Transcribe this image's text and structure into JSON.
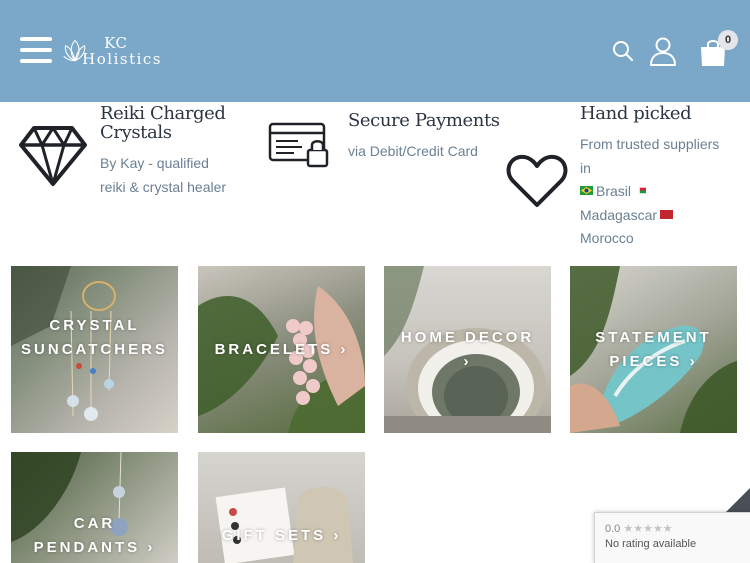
{
  "header": {
    "logo_line1": "KC",
    "logo_line2": "Holistics",
    "cart_count": "0",
    "bg_color": "#7ba8c9"
  },
  "features": [
    {
      "icon": "diamond-icon",
      "title_line1": "Reiki Charged",
      "title_line2": "Crystals",
      "sub_line1": "By Kay - qualified",
      "sub_line2": "reiki & crystal healer"
    },
    {
      "icon": "secure-card-icon",
      "title_line1": "Secure Payments",
      "sub_line1": "via Debit/Credit Card"
    },
    {
      "icon": "heart-icon",
      "title_line1": "Hand picked",
      "sub_line1": "From trusted suppliers",
      "sub_line2": "in",
      "country1": "Brasil",
      "country2": "Madagascar",
      "country3": "Morocco"
    }
  ],
  "tiles": [
    {
      "line1": "CRYSTAL",
      "line2": "SUNCATCHERS"
    },
    {
      "line1": "BRACELETS ›"
    },
    {
      "line1": "HOME DECOR",
      "line2": "›"
    },
    {
      "line1": "STATEMENT",
      "line2": "PIECES ›"
    },
    {
      "line1": "CAR",
      "line2": "PENDANTS ›"
    },
    {
      "line1": "GIFT SETS ›"
    }
  ],
  "recaptcha": {
    "score": "0.0",
    "stars": "★★★★★",
    "text": "No rating available"
  }
}
